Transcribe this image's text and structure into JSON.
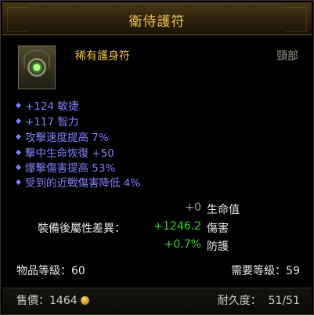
{
  "tooltip": {
    "title": "衛侍護符",
    "rarity_type": "稀有護身符",
    "slot": "頸部",
    "icon": "amulet-icon",
    "affixes": [
      "+124 敏捷",
      "+117 智力",
      "攻擊速度提高 7%",
      "擊中生命恢復 +50",
      "爆擊傷害提高 53%",
      "受到的近戰傷害降低 4%"
    ],
    "compare_label": "裝備後屬性差異：",
    "compare": [
      {
        "value": "+0",
        "stat": "生命值",
        "color": "#9a9a9a"
      },
      {
        "value": "+1246.2",
        "stat": "傷害",
        "color": "#2fd62f"
      },
      {
        "value": "+0.7%",
        "stat": "防護",
        "color": "#2fd62f"
      }
    ],
    "item_level": "物品等級：60",
    "required_level": "需要等級：59",
    "price_label": "售價：1464",
    "durability_label": "耐久度：",
    "durability_value": "51/51"
  },
  "colors": {
    "title": "#f3c14a",
    "affix": "#7f7fff",
    "positive": "#2fd62f",
    "neutral": "#9a9a9a"
  }
}
